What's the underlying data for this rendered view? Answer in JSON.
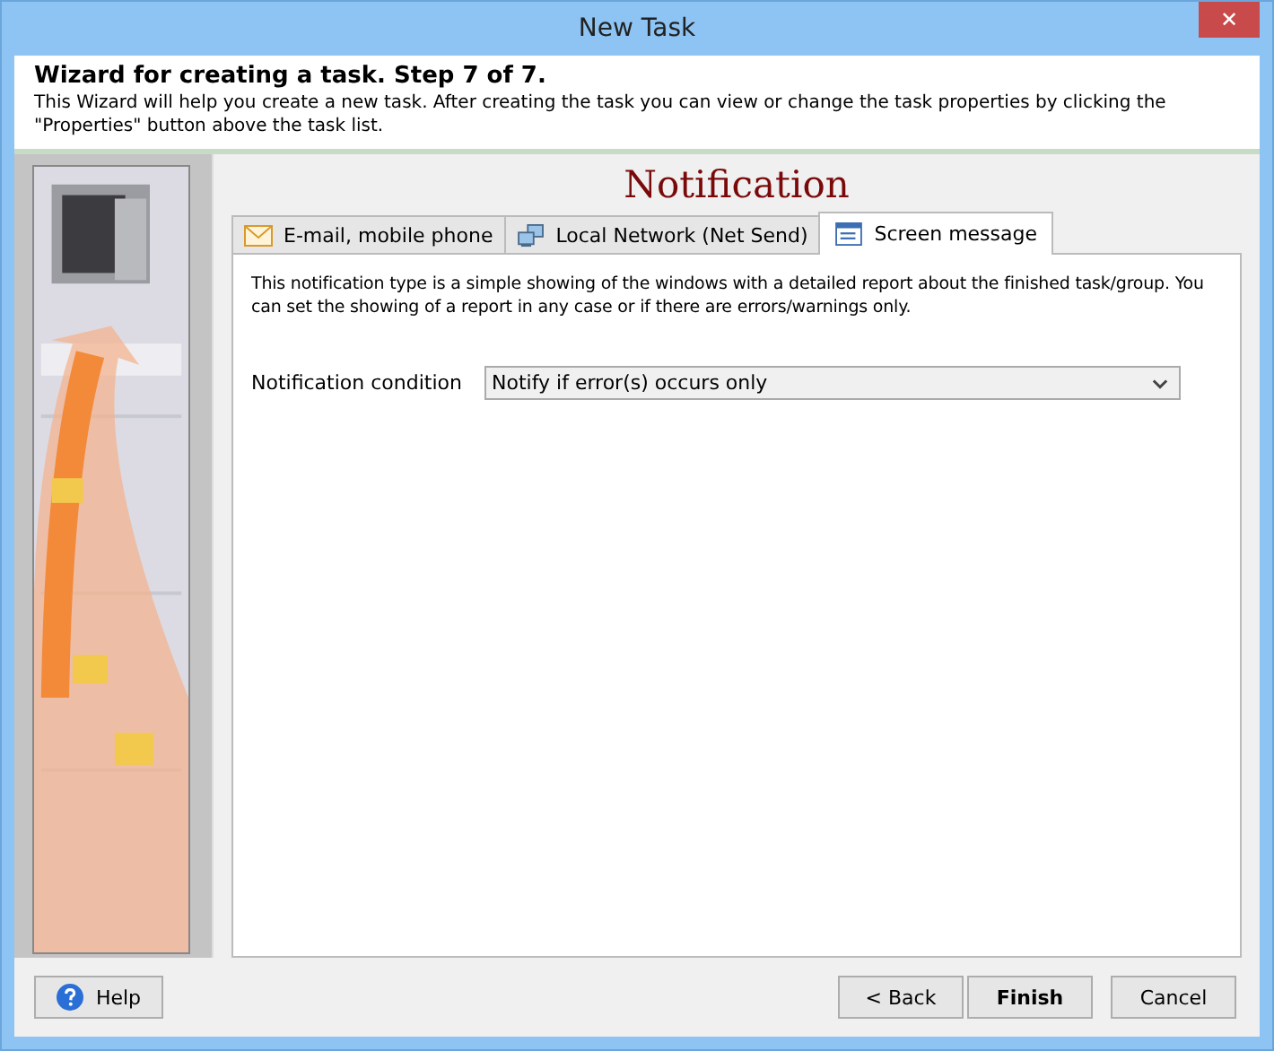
{
  "window": {
    "title": "New Task",
    "close_symbol": "✕"
  },
  "header": {
    "title": "Wizard for creating a task. Step 7 of 7.",
    "description": "This Wizard will help you create a new task. After creating the task you can view or change the task properties by clicking the \"Properties\" button above the task list."
  },
  "page_title": "Notification",
  "tabs": [
    {
      "label": "E-mail, mobile phone",
      "kind": "mail",
      "selected": false
    },
    {
      "label": "Local Network (Net Send)",
      "kind": "network",
      "selected": false
    },
    {
      "label": "Screen message",
      "kind": "window",
      "selected": true
    }
  ],
  "description": "This notification type is a simple showing of the windows with a detailed report about the finished task/group. You can set the showing of a report in any case or if there are errors/warnings only.",
  "condition": {
    "label": "Notification condition",
    "value": "Notify if error(s) occurs only"
  },
  "buttons": [
    {
      "label": "Help",
      "kind": "help"
    },
    {
      "label": "< Back",
      "kind": "back"
    },
    {
      "label": "Finish",
      "kind": "finish"
    },
    {
      "label": "Cancel",
      "kind": "cancel"
    }
  ]
}
